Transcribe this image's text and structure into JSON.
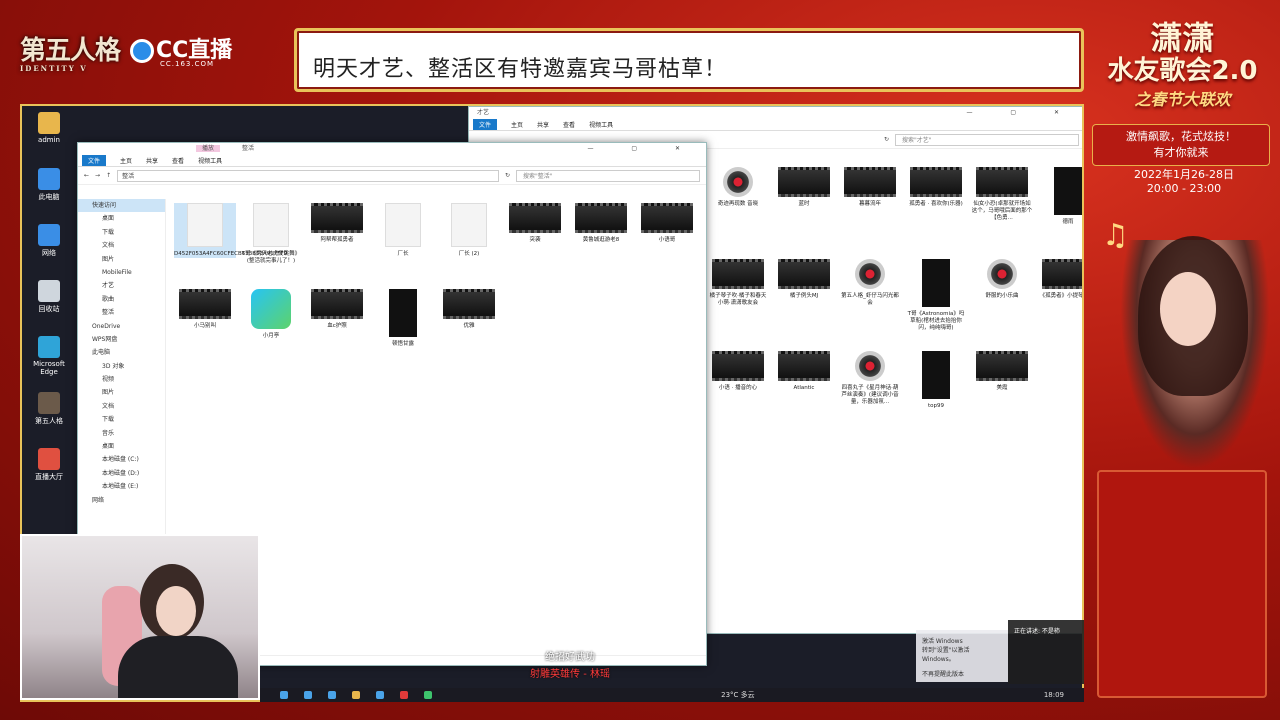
{
  "overlay": {
    "logo_identity": "第五人格",
    "logo_identity_sub": "IDENTITY V",
    "logo_cc": "CC直播",
    "logo_cc_sub": "CC.163.COM",
    "banner_text": "明天才艺、整活区有特邀嘉宾马哥枯草！",
    "event_line1": "潇潇",
    "event_line2": "水友歌会2.0",
    "event_line3": "之春节大联欢",
    "event_slogan1": "激情飙歌，花式炫技！",
    "event_slogan2": "有才你就来",
    "event_date": "2022年1月26-28日",
    "event_time": "20:00 - 23:00"
  },
  "desktop_icons": [
    {
      "label": "admin",
      "color": "#e8b64c"
    },
    {
      "label": "此电脑",
      "color": "#3a8ee6"
    },
    {
      "label": "网络",
      "color": "#3a8ee6"
    },
    {
      "label": "回收站",
      "color": "#cfd6dd"
    },
    {
      "label": "Microsoft Edge",
      "color": "#2fa4d8"
    },
    {
      "label": "第五人格",
      "color": "#6b5a4a"
    },
    {
      "label": "直播大厅",
      "color": "#e05040"
    }
  ],
  "front_window": {
    "title": "整活",
    "tabs": {
      "file": "文件",
      "home": "主页",
      "share": "共享",
      "view": "查看",
      "tools": "视频工具",
      "play": "播放"
    },
    "address": "整活",
    "search_placeholder": "搜索\"整活\"",
    "nav": [
      {
        "label": "快速访问",
        "sel": true,
        "indent": false
      },
      {
        "label": "桌面",
        "indent": true
      },
      {
        "label": "下载",
        "indent": true
      },
      {
        "label": "文档",
        "indent": true
      },
      {
        "label": "图片",
        "indent": true
      },
      {
        "label": "MobileFile",
        "indent": true
      },
      {
        "label": "才艺",
        "indent": true
      },
      {
        "label": "歌曲",
        "indent": true
      },
      {
        "label": "整活",
        "indent": true
      },
      {
        "label": "OneDrive",
        "indent": false
      },
      {
        "label": "WPS网盘",
        "indent": false
      },
      {
        "label": "此电脑",
        "indent": false
      },
      {
        "label": "3D 对象",
        "indent": true
      },
      {
        "label": "视频",
        "indent": true
      },
      {
        "label": "图片",
        "indent": true
      },
      {
        "label": "文档",
        "indent": true
      },
      {
        "label": "下载",
        "indent": true
      },
      {
        "label": "音乐",
        "indent": true
      },
      {
        "label": "桌面",
        "indent": true
      },
      {
        "label": "本地磁盘 (C:)",
        "indent": true
      },
      {
        "label": "本地磁盘 (D:)",
        "indent": true
      },
      {
        "label": "本地磁盘 (E:)",
        "indent": true
      },
      {
        "label": "网络",
        "indent": false
      }
    ],
    "files": [
      {
        "label": "D452F053A4FC60CFECB633B53A917FF9",
        "kind": "doc",
        "sel": true
      },
      {
        "label": "T哥《两只老虎爱跳舞》(整活就完事儿了！)",
        "kind": "doc"
      },
      {
        "label": "阿帮帮孤勇者",
        "kind": "video"
      },
      {
        "label": "厂长",
        "kind": "doc"
      },
      {
        "label": "厂长 (2)",
        "kind": "doc"
      },
      {
        "label": "突袭",
        "kind": "video"
      },
      {
        "label": "黄鲁城逛游老8",
        "kind": "video"
      },
      {
        "label": "小语哥",
        "kind": "video"
      },
      {
        "label": "小马别叫",
        "kind": "video"
      },
      {
        "label": "小月亭",
        "kind": "app"
      },
      {
        "label": "血c护照",
        "kind": "video"
      },
      {
        "label": "顿悟甘露",
        "kind": "tall"
      },
      {
        "label": "优雅",
        "kind": "video"
      }
    ]
  },
  "back_window": {
    "title": "才艺",
    "search_placeholder": "搜索\"才艺\"",
    "files": [
      {
        "label": "奇迹再现数 音晓",
        "kind": "cd"
      },
      {
        "label": "蓝时",
        "kind": "video"
      },
      {
        "label": "暮暮流年",
        "kind": "video"
      },
      {
        "label": "孤勇者 · 喜欢你(乐器)",
        "kind": "video"
      },
      {
        "label": "仙女小恐(卓那就开场如这个，马哥哦后面的那个【色勇...",
        "kind": "video"
      },
      {
        "label": "德雨",
        "kind": "tall"
      },
      {
        "label": "橘子琴子吹·橘子和春天小萌·潇潇歌友会",
        "kind": "video"
      },
      {
        "label": "橘子例头MJ",
        "kind": "video"
      },
      {
        "label": "第五人格_虾仔马闪光都会",
        "kind": "cd"
      },
      {
        "label": "T哥《Astronomia》吗草船(棺材进去抬抬你闪，纯纯嗨哥)",
        "kind": "tall"
      },
      {
        "label": "舒服的小乐曲",
        "kind": "cd"
      },
      {
        "label": "《孤勇者》小提琴 古筝",
        "kind": "video"
      },
      {
        "label": "小语 · 播音的心",
        "kind": "video"
      },
      {
        "label": "Atlantic",
        "kind": "video"
      },
      {
        "label": "四喜丸子《星月神话·葫芦丝演奏》(建议调小音量，乐器加氛...",
        "kind": "cd"
      },
      {
        "label": "top99",
        "kind": "tall"
      },
      {
        "label": "美霞",
        "kind": "video"
      }
    ]
  },
  "lyrics": {
    "line1": "绝招好武功",
    "line2": "射雕英雄传 - 林瑶"
  },
  "taskbar": {
    "weather": "23°C 多云",
    "clock": "18:09"
  },
  "toast": {
    "text": "激活 Windows",
    "sub": "转到\"设置\"以激活 Windows。",
    "dismiss": "不再提醒此版本"
  },
  "rec_toast": {
    "text": "正在讲述: 不是柿"
  }
}
